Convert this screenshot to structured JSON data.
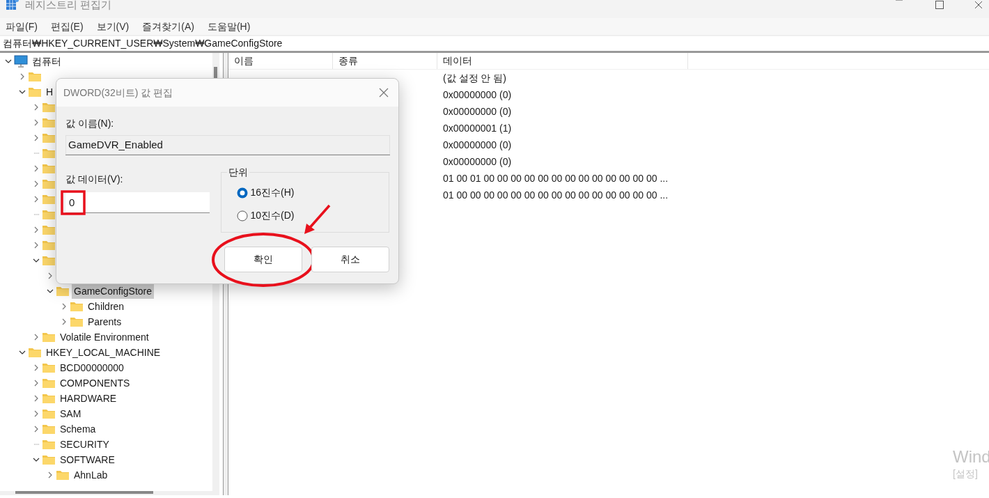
{
  "window": {
    "title": "레지스트리 편집기"
  },
  "menu": [
    "파일(F)",
    "편집(E)",
    "보기(V)",
    "즐겨찾기(A)",
    "도움말(H)"
  ],
  "address": "컴퓨터₩HKEY_CURRENT_USER₩System₩GameConfigStore",
  "tree": [
    {
      "label": "컴퓨터",
      "kind": "computer",
      "has_children": true,
      "expanded": true,
      "selected": false,
      "children": [
        {
          "kind": "folder",
          "has_children": true,
          "expanded": false,
          "selected": false
        },
        {
          "label": "H",
          "kind": "folder",
          "has_children": true,
          "expanded": true,
          "selected": false,
          "children": [
            {
              "kind": "folder",
              "has_children": true,
              "expanded": false,
              "selected": false
            },
            {
              "kind": "folder",
              "has_children": true,
              "expanded": false,
              "selected": false
            },
            {
              "kind": "folder",
              "has_children": true,
              "expanded": false,
              "selected": false
            },
            {
              "kind": "folder",
              "has_children": false,
              "selected": false
            },
            {
              "kind": "folder",
              "has_children": true,
              "expanded": false,
              "selected": false
            },
            {
              "kind": "folder",
              "has_children": true,
              "expanded": false,
              "selected": false
            },
            {
              "kind": "folder",
              "has_children": true,
              "expanded": false,
              "selected": false
            },
            {
              "kind": "folder",
              "has_children": false,
              "selected": false
            },
            {
              "kind": "folder",
              "has_children": true,
              "expanded": false,
              "selected": false
            },
            {
              "kind": "folder",
              "has_children": true,
              "expanded": false,
              "selected": false
            },
            {
              "kind": "folder",
              "has_children": true,
              "expanded": true,
              "selected": false,
              "children": [
                {
                  "has_children": true,
                  "expanded": false
                },
                {
                  "label": "GameConfigStore",
                  "kind": "folder",
                  "has_children": true,
                  "expanded": true,
                  "selected": true,
                  "children": [
                    {
                      "label": "Children",
                      "kind": "folder",
                      "has_children": true,
                      "expanded": false,
                      "selected": false
                    },
                    {
                      "label": "Parents",
                      "kind": "folder",
                      "has_children": true,
                      "expanded": false,
                      "selected": false
                    }
                  ]
                }
              ]
            },
            {
              "label": "Volatile Environment",
              "kind": "folder",
              "has_children": true,
              "expanded": false,
              "selected": false
            }
          ]
        },
        {
          "label": "HKEY_LOCAL_MACHINE",
          "kind": "folder",
          "has_children": true,
          "expanded": true,
          "selected": false,
          "children": [
            {
              "label": "BCD00000000",
              "kind": "folder",
              "has_children": true,
              "expanded": false,
              "selected": false
            },
            {
              "label": "COMPONENTS",
              "kind": "folder",
              "has_children": true,
              "expanded": false,
              "selected": false
            },
            {
              "label": "HARDWARE",
              "kind": "folder",
              "has_children": true,
              "expanded": false,
              "selected": false
            },
            {
              "label": "SAM",
              "kind": "folder",
              "has_children": true,
              "expanded": false,
              "selected": false
            },
            {
              "label": "Schema",
              "kind": "folder",
              "has_children": true,
              "expanded": false,
              "selected": false
            },
            {
              "label": "SECURITY",
              "kind": "folder",
              "has_children": false,
              "selected": false
            },
            {
              "label": "SOFTWARE",
              "kind": "folder",
              "has_children": true,
              "expanded": true,
              "selected": false,
              "children": [
                {
                  "label": "AhnLab",
                  "kind": "folder",
                  "has_children": true,
                  "expanded": false,
                  "selected": false
                }
              ]
            }
          ]
        }
      ]
    }
  ],
  "list": {
    "columns": [
      "이름",
      "종류",
      "데이터"
    ],
    "rows": [
      {
        "data": "(값 설정 안 됨)"
      },
      {
        "data": "0x00000000 (0)"
      },
      {
        "data": "0x00000000 (0)"
      },
      {
        "data": "0x00000001 (1)"
      },
      {
        "data": "0x00000000 (0)"
      },
      {
        "data": "0x00000000 (0)"
      },
      {
        "data": "01 00 01 00 00 00 00 00 00 00 00 00 00 00 00 00 ..."
      },
      {
        "data": "01 00 00 00 00 00 00 00 00 00 00 00 00 00 00 00 ..."
      }
    ]
  },
  "dialog": {
    "title": "DWORD(32비트) 값 편집",
    "name_label": "값 이름(N):",
    "name_value": "GameDVR_Enabled",
    "data_label": "값 데이터(V):",
    "data_value": "0",
    "data_highlighted": true,
    "group_label": "단위",
    "radios": [
      {
        "label": "16진수(H)",
        "selected": true
      },
      {
        "label": "10진수(D)",
        "selected": false
      }
    ],
    "buttons": [
      {
        "label": "확인",
        "circled": true
      },
      {
        "label": "취소",
        "circled": false
      }
    ]
  },
  "activation_notice": [
    "Wind",
    "[설정]"
  ]
}
